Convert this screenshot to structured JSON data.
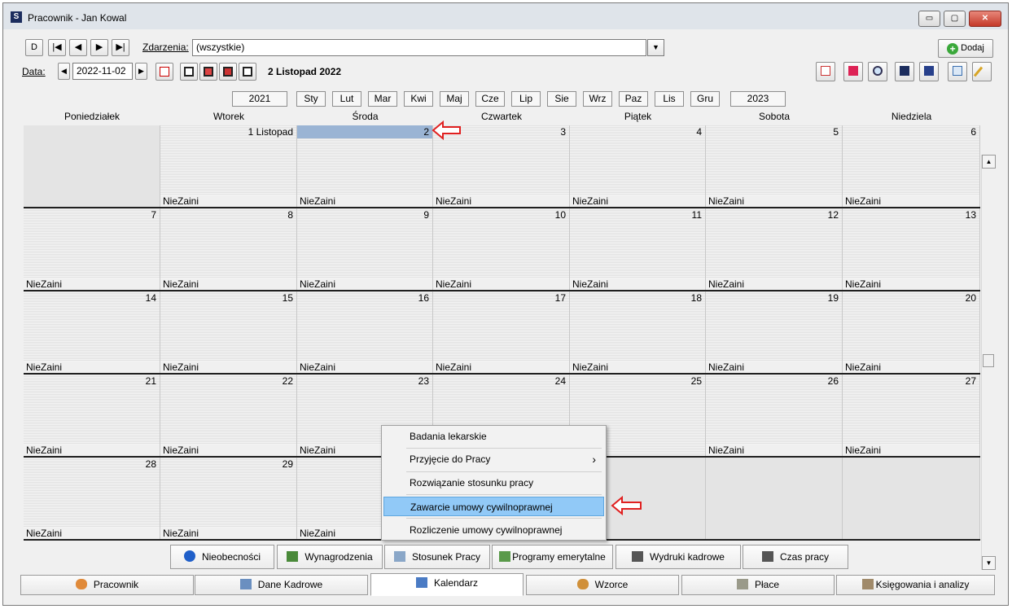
{
  "window": {
    "title": "Pracownik - Jan Kowal",
    "minimize": "▭",
    "maximize": "▢",
    "close": "✕"
  },
  "toolbar": {
    "nav_buttons": [
      "D",
      "|◀",
      "◀",
      "▶",
      "▶|"
    ],
    "events_label": "Zdarzenia:",
    "events_value": "(wszystkie)",
    "add_button": "Dodaj",
    "date_label": "Data:",
    "date_value": "2022-11-02",
    "date_display": "2 Listopad 2022"
  },
  "year_nav": {
    "prev": "2021",
    "next": "2023"
  },
  "months": [
    "Sty",
    "Lut",
    "Mar",
    "Kwi",
    "Maj",
    "Cze",
    "Lip",
    "Sie",
    "Wrz",
    "Paz",
    "Lis",
    "Gru"
  ],
  "weekdays": [
    "Poniedziałek",
    "Wtorek",
    "Środa",
    "Czwartek",
    "Piątek",
    "Sobota",
    "Niedziela"
  ],
  "weeks": [
    [
      {
        "num": "",
        "ev": ""
      },
      {
        "num": "1 Listopad",
        "ev": "NieZaini"
      },
      {
        "num": "2",
        "ev": "NieZaini",
        "selected": true
      },
      {
        "num": "3",
        "ev": "NieZaini"
      },
      {
        "num": "4",
        "ev": "NieZaini"
      },
      {
        "num": "5",
        "ev": "NieZaini"
      },
      {
        "num": "6",
        "ev": "NieZaini"
      }
    ],
    [
      {
        "num": "7",
        "ev": "NieZaini"
      },
      {
        "num": "8",
        "ev": "NieZaini"
      },
      {
        "num": "9",
        "ev": "NieZaini"
      },
      {
        "num": "10",
        "ev": "NieZaini"
      },
      {
        "num": "11",
        "ev": "NieZaini"
      },
      {
        "num": "12",
        "ev": "NieZaini"
      },
      {
        "num": "13",
        "ev": "NieZaini"
      }
    ],
    [
      {
        "num": "14",
        "ev": "NieZaini"
      },
      {
        "num": "15",
        "ev": "NieZaini"
      },
      {
        "num": "16",
        "ev": "NieZaini"
      },
      {
        "num": "17",
        "ev": "NieZaini"
      },
      {
        "num": "18",
        "ev": "NieZaini"
      },
      {
        "num": "19",
        "ev": "NieZaini"
      },
      {
        "num": "20",
        "ev": "NieZaini"
      }
    ],
    [
      {
        "num": "21",
        "ev": "NieZaini"
      },
      {
        "num": "22",
        "ev": "NieZaini"
      },
      {
        "num": "23",
        "ev": "NieZaini"
      },
      {
        "num": "24",
        "ev": "NieZaini"
      },
      {
        "num": "25",
        "ev": ""
      },
      {
        "num": "26",
        "ev": "NieZaini"
      },
      {
        "num": "27",
        "ev": "NieZaini"
      }
    ],
    [
      {
        "num": "28",
        "ev": "NieZaini"
      },
      {
        "num": "29",
        "ev": "NieZaini"
      },
      {
        "num": "",
        "ev": "NieZaini"
      },
      {
        "num": "",
        "ev": ""
      },
      {
        "num": "",
        "ev": "",
        "empty": true
      },
      {
        "num": "",
        "ev": "",
        "empty": true
      },
      {
        "num": "",
        "ev": "",
        "empty": true
      }
    ]
  ],
  "context_menu": [
    {
      "label": "Badania lekarskie"
    },
    {
      "label": "Przyjęcie do Pracy",
      "submenu": true
    },
    {
      "label": "Rozwiązanie stosunku pracy"
    },
    {
      "label": "Zawarcie umowy cywilnoprawnej",
      "highlighted": true
    },
    {
      "label": "Rozliczenie umowy cywilnoprawnej"
    }
  ],
  "submenu_arrow": "›",
  "sub_tabs": [
    "Nieobecności",
    "Wynagrodzenia",
    "Stosunek Pracy",
    "Programy emerytalne",
    "Wydruki kadrowe",
    "Czas pracy"
  ],
  "main_tabs": [
    "Pracownik",
    "Dane Kadrowe",
    "Kalendarz",
    "Wzorce",
    "Płace",
    "Księgowania i analizy"
  ],
  "active_main_tab": "Kalendarz",
  "colors": {
    "selected_day": "#9ab4d4",
    "menu_highlight": "#91c9f7",
    "annotation_arrow": "#e02020"
  }
}
